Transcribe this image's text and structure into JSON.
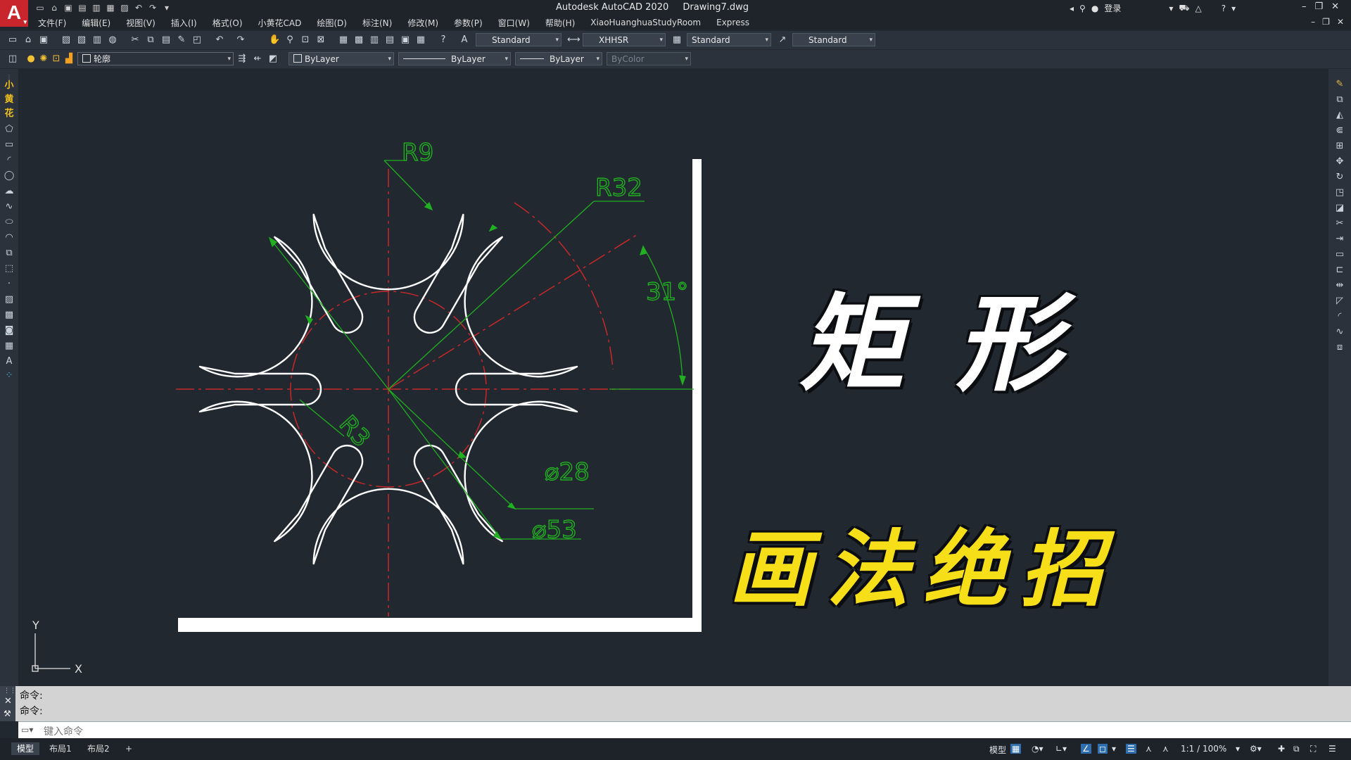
{
  "titlebar": {
    "app_title": "Autodesk AutoCAD 2020",
    "doc_title": "Drawing7.dwg",
    "login": "登录",
    "logo_letter": "A"
  },
  "menu": [
    "文件(F)",
    "编辑(E)",
    "视图(V)",
    "插入(I)",
    "格式(O)",
    "小黄花CAD",
    "绘图(D)",
    "标注(N)",
    "修改(M)",
    "参数(P)",
    "窗口(W)",
    "帮助(H)",
    "XiaoHuanghuaStudyRoom",
    "Express"
  ],
  "toolbar": {
    "text_style": "Standard",
    "dim_style": "XHHSR",
    "table_style": "Standard",
    "mleader_style": "Standard",
    "layer": "轮廓",
    "color": "ByLayer",
    "linetype": "ByLayer",
    "lineweight": "ByLayer",
    "plotstyle": "ByColor"
  },
  "left_toolbar_chars": [
    "小",
    "黄",
    "花"
  ],
  "drawing": {
    "dims": {
      "r9": "R9",
      "r32": "R32",
      "angle": "31°",
      "r3": "R3",
      "d28": "⌀28",
      "d53": "⌀53"
    },
    "ucs": {
      "x": "X",
      "y": "Y"
    },
    "colors": {
      "geometry": "#ffffff",
      "dimension": "#20b020",
      "center": "#c82828"
    }
  },
  "overlay": {
    "line1": "矩 形",
    "line2": "画法绝招"
  },
  "command": {
    "history": [
      "命令:",
      "命令:"
    ],
    "placeholder": "键入命令"
  },
  "layout_tabs": [
    "模型",
    "布局1",
    "布局2"
  ],
  "status": {
    "model": "模型",
    "scale": "1:1 / 100%"
  }
}
